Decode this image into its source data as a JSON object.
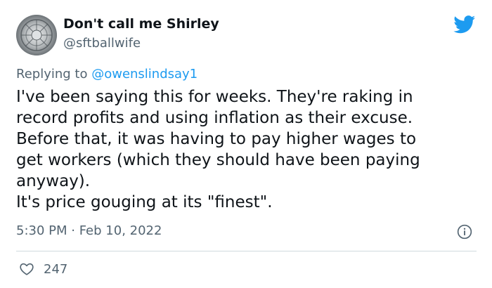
{
  "author": {
    "display_name": "Don't call me Shirley",
    "handle": "@sftballwife",
    "avatar_icon": "avatar-photo"
  },
  "brand": {
    "icon": "twitter-bird-icon",
    "color": "#1d9bf0"
  },
  "reply": {
    "prefix": "Replying to ",
    "to_handle": "@owenslindsay1"
  },
  "tweet": {
    "lines": [
      "I've been saying this for weeks. They're raking in",
      "record profits and using inflation as their excuse.",
      "Before that, it was having to pay higher wages to",
      "get workers (which they should have been paying",
      "anyway).",
      "It's price gouging at its \"finest\"."
    ]
  },
  "meta": {
    "timestamp": "5:30 PM · Feb 10, 2022",
    "info_icon": "info-icon"
  },
  "engagement": {
    "likes_icon": "heart-icon",
    "likes_count": "247"
  },
  "colors": {
    "text": "#0f1419",
    "secondary": "#536471",
    "link": "#1d9bf0",
    "divider": "#cfd9de"
  }
}
